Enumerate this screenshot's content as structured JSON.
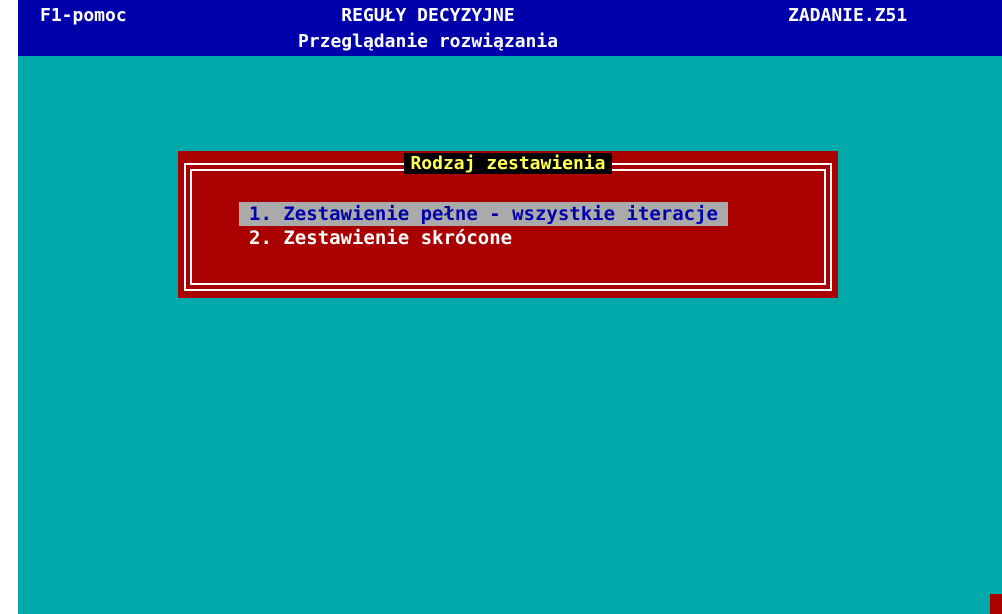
{
  "header": {
    "help_label": "F1-pomoc",
    "title": "REGUŁY DECYZYJNE",
    "subtitle": "Przeglądanie rozwiązania",
    "task_name": "ZADANIE.Z51"
  },
  "dialog": {
    "title": "Rodzaj zestawienia",
    "items": [
      {
        "label": "1. Zestawienie pełne - wszystkie iteracje",
        "selected": true
      },
      {
        "label": "2. Zestawienie skrócone",
        "selected": false
      }
    ]
  },
  "colors": {
    "background": "#00aaaa",
    "header_bg": "#0000aa",
    "dialog_bg": "#aa0000",
    "highlight_bg": "#aaaaaa",
    "title_fg": "#ffff55"
  }
}
